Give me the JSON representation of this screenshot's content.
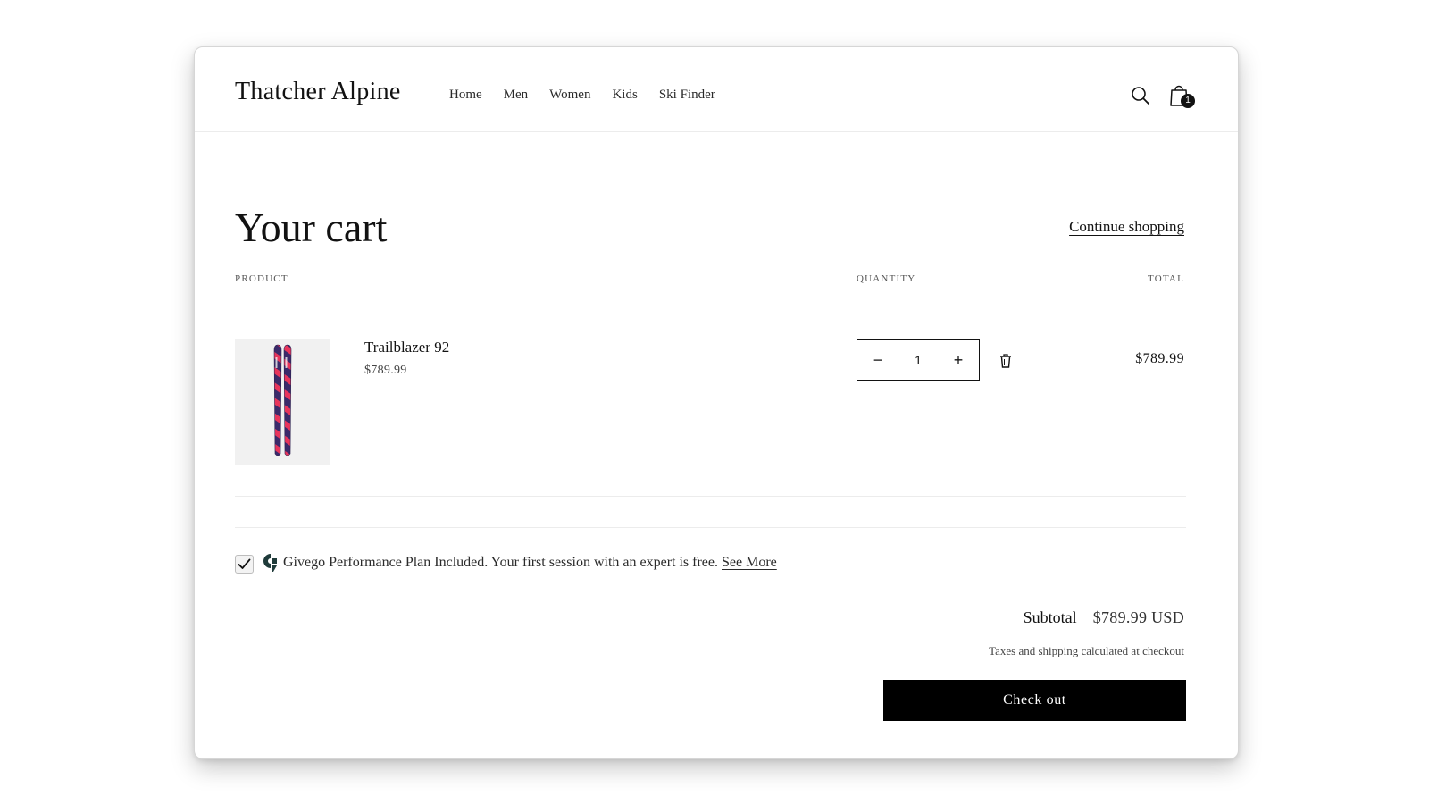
{
  "header": {
    "logo": "Thatcher Alpine",
    "nav": [
      "Home",
      "Men",
      "Women",
      "Kids",
      "Ski Finder"
    ],
    "search_icon": "search-icon",
    "cart_icon": "shopping-bag-icon",
    "cart_count": "1"
  },
  "cart": {
    "title": "Your cart",
    "continue_label": "Continue shopping",
    "columns": {
      "product": "Product",
      "quantity": "Quantity",
      "total": "Total"
    },
    "items": [
      {
        "name": "Trailblazer 92",
        "price": "$789.99",
        "quantity": "1",
        "minus_symbol": "−",
        "plus_symbol": "+",
        "remove_icon": "trash-icon",
        "total": "$789.99",
        "image_colors": {
          "base": "#3b2a6b",
          "accent": "#e8355c"
        }
      }
    ]
  },
  "plan": {
    "checked": true,
    "text": "Givego Performance Plan Included. Your first session with an expert is free.",
    "link": "See More",
    "logo_color": "#1f3b3a"
  },
  "summary": {
    "subtotal_label": "Subtotal",
    "subtotal_value": "$789.99 USD",
    "taxes_note": "Taxes and shipping calculated at checkout",
    "checkout_label": "Check out"
  }
}
